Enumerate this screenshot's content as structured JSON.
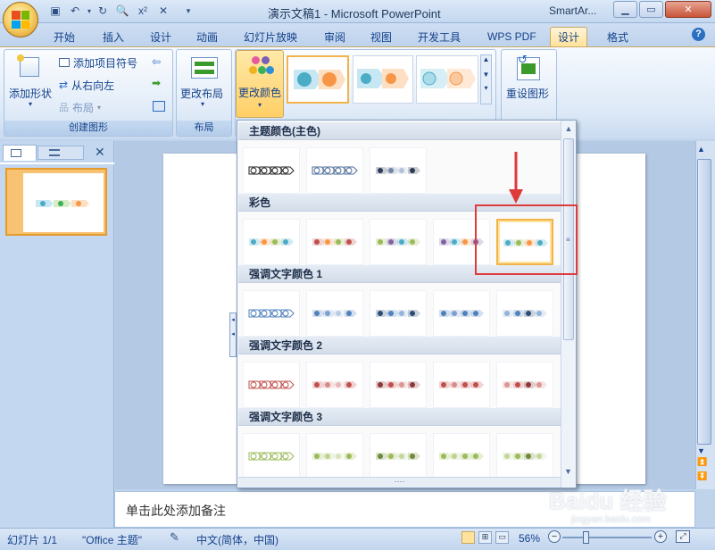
{
  "window": {
    "title": "演示文稿1 - Microsoft PowerPoint",
    "tool_title": "SmartAr..."
  },
  "tabs": [
    "开始",
    "插入",
    "设计",
    "动画",
    "幻灯片放映",
    "审阅",
    "视图",
    "开发工具",
    "WPS PDF",
    "设计",
    "格式"
  ],
  "ribbon": {
    "create_graphic": {
      "add_shape": "添加形状",
      "add_bullet": "添加项目符号",
      "right_to_left": "从右向左",
      "layout": "布局",
      "label": "创建图形"
    },
    "layouts": {
      "change_layout": "更改布局",
      "label": "布局"
    },
    "styles": {
      "change_color": "更改颜色"
    },
    "reset": {
      "reset_graphic": "重设图形"
    }
  },
  "gallery": {
    "sections": [
      {
        "title": "主题颜色(主色)",
        "items": 3,
        "colors": [
          [
            "#222222",
            "#222222",
            "#222222"
          ],
          [
            "#4f6d9a",
            "#4f6d9a",
            "#4f6d9a"
          ],
          [
            "#2b3b55",
            "#6f85a8",
            "#b4c1d6"
          ]
        ]
      },
      {
        "title": "彩色",
        "items": 5,
        "colors": [
          [
            "#4bacc6",
            "#f79646",
            "#9bbb59"
          ],
          [
            "#c0504d",
            "#f79646",
            "#9bbb59"
          ],
          [
            "#9bbb59",
            "#8064a2",
            "#4bacc6"
          ],
          [
            "#8064a2",
            "#4bacc6",
            "#f79646"
          ],
          [
            "#4bacc6",
            "#9bbb59",
            "#f79646"
          ]
        ]
      },
      {
        "title": "强调文字颜色 1",
        "items": 5,
        "colors": [
          [
            "#4f81bd",
            "#4f81bd",
            "#4f81bd"
          ],
          [
            "#4f81bd",
            "#7ba0d0",
            "#b8cce4"
          ],
          [
            "#2c4d75",
            "#4f81bd",
            "#95b3d7"
          ],
          [
            "#4f81bd",
            "#7ba0d0",
            "#4f81bd"
          ],
          [
            "#95b3d7",
            "#4f81bd",
            "#2c4d75"
          ]
        ]
      },
      {
        "title": "强调文字颜色 2",
        "items": 5,
        "colors": [
          [
            "#c0504d",
            "#c0504d",
            "#c0504d"
          ],
          [
            "#c0504d",
            "#d88a88",
            "#e6b9b8"
          ],
          [
            "#8c3836",
            "#c0504d",
            "#da9694"
          ],
          [
            "#c0504d",
            "#d88a88",
            "#c0504d"
          ],
          [
            "#da9694",
            "#c0504d",
            "#8c3836"
          ]
        ]
      },
      {
        "title": "强调文字颜色 3",
        "items": 5,
        "colors": [
          [
            "#9bbb59",
            "#9bbb59",
            "#9bbb59"
          ],
          [
            "#9bbb59",
            "#bcd38f",
            "#d7e4bd"
          ],
          [
            "#6f8a3a",
            "#9bbb59",
            "#c3d69b"
          ],
          [
            "#9bbb59",
            "#bcd38f",
            "#9bbb59"
          ],
          [
            "#c3d69b",
            "#9bbb59",
            "#6f8a3a"
          ]
        ]
      }
    ],
    "selected_section": 1,
    "selected_item": 4
  },
  "slide_pane": {
    "slide_number": "1"
  },
  "notes": {
    "placeholder": "单击此处添加备注"
  },
  "status": {
    "slide": "幻灯片 1/1",
    "theme": "\"Office 主题\"",
    "language": "中文(简体，中国)",
    "zoom": "56%"
  },
  "watermark": "Baidu 经验",
  "watermark_url": "jingyan.baidu.com",
  "colors": {
    "highlight": "#e03b3b",
    "accent": "#f7c271"
  }
}
